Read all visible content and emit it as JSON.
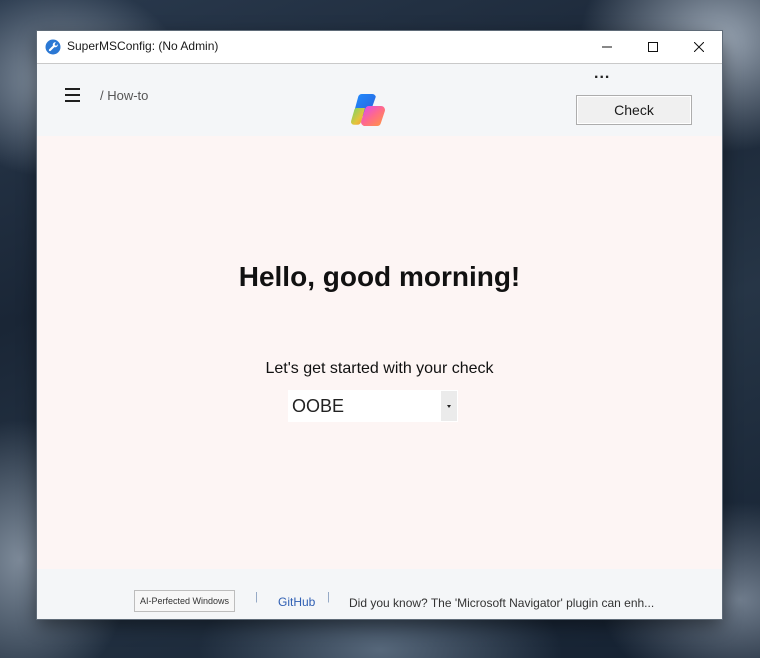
{
  "window": {
    "title": "SuperMSConfig: (No Admin)"
  },
  "header": {
    "breadcrumb": "/ How-to",
    "more_label": "...",
    "check_label": "Check"
  },
  "main": {
    "greeting": "Hello, good morning!",
    "subtitle": "Let's get started with your check",
    "mode_select": {
      "selected": "OOBE"
    }
  },
  "footer": {
    "badge": "AI-Perfected Windows",
    "separator": "|",
    "github_label": "GitHub",
    "tip": "Did you know? The 'Microsoft Navigator' plugin can enh..."
  },
  "icons": {
    "app": "wrench-icon",
    "menu": "hamburger-menu-icon",
    "logo": "copilot-logo-icon",
    "dropdown": "chevron-down-icon"
  },
  "colors": {
    "content_bg": "#fdf5f4",
    "header_bg": "#f4f6f8",
    "link": "#2f5fb3"
  }
}
